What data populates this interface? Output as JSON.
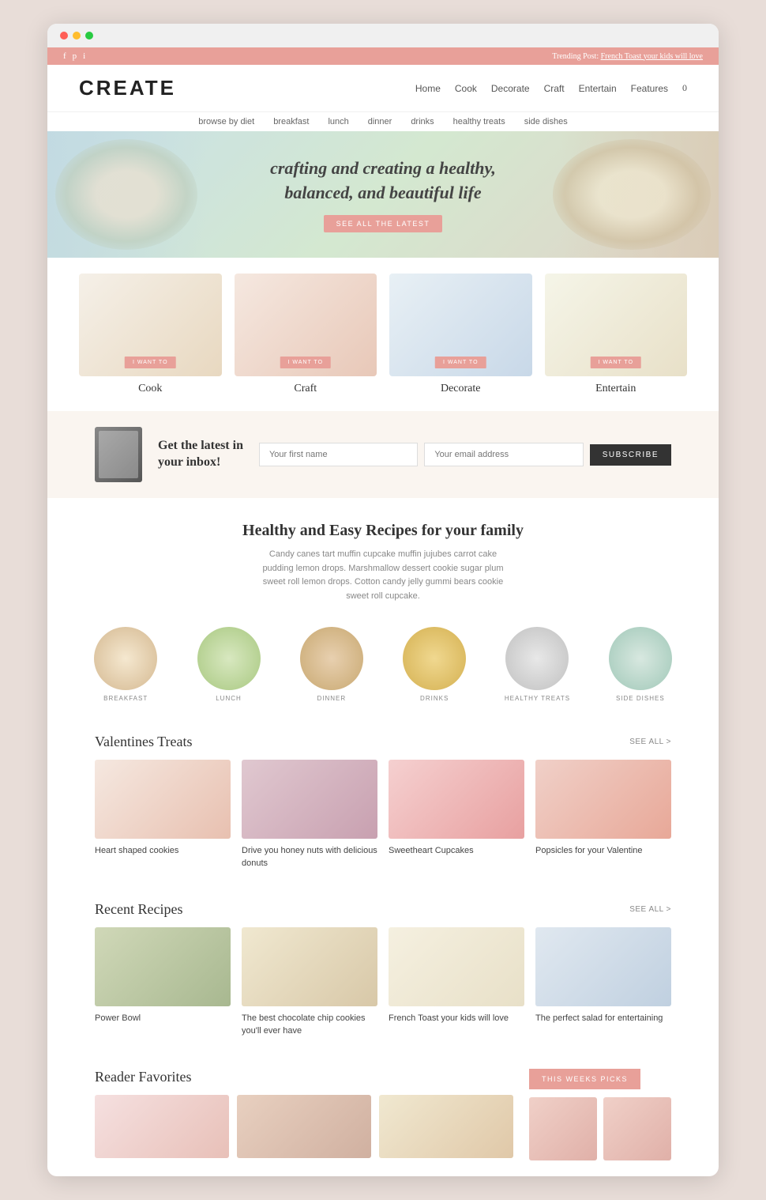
{
  "browser": {
    "dots": [
      "red",
      "yellow",
      "green"
    ]
  },
  "topbar": {
    "social_icons": [
      "f",
      "p",
      "i"
    ],
    "trending_label": "Trending Post:",
    "trending_link": "French Toast your kids will love"
  },
  "header": {
    "logo": "CREATE",
    "nav": [
      {
        "label": "Home",
        "has_dropdown": true
      },
      {
        "label": "Cook"
      },
      {
        "label": "Decorate"
      },
      {
        "label": "Craft"
      },
      {
        "label": "Entertain"
      },
      {
        "label": "Features",
        "has_dropdown": true
      },
      {
        "label": "0"
      }
    ]
  },
  "subnav": {
    "items": [
      {
        "label": "browse by diet"
      },
      {
        "label": "breakfast"
      },
      {
        "label": "lunch"
      },
      {
        "label": "dinner"
      },
      {
        "label": "drinks"
      },
      {
        "label": "healthy treats"
      },
      {
        "label": "side dishes"
      }
    ]
  },
  "hero": {
    "heading_line1": "crafting and creating a healthy,",
    "heading_line2": "balanced, and beautiful life",
    "button_label": "SEE ALL THE LATEST"
  },
  "categories": [
    {
      "label": "Cook",
      "btn": "I WANT TO",
      "img_class": "category-img-cook"
    },
    {
      "label": "Craft",
      "btn": "I WANT TO",
      "img_class": "category-img-craft"
    },
    {
      "label": "Decorate",
      "btn": "I WANT TO",
      "img_class": "category-img-decorate"
    },
    {
      "label": "Entertain",
      "btn": "I WANT TO",
      "img_class": "category-img-entertain"
    }
  ],
  "newsletter": {
    "heading_line1": "Get the latest in",
    "heading_line2": "your inbox!",
    "first_name_placeholder": "Your first name",
    "email_placeholder": "Your email address",
    "button_label": "SUBSCRIBE"
  },
  "recipes": {
    "title": "Healthy and Easy Recipes for your family",
    "description": "Candy canes tart muffin cupcake muffin jujubes carrot cake pudding lemon drops. Marshmallow dessert cookie sugar plum sweet roll lemon drops. Cotton candy jelly gummi bears cookie sweet roll cupcake.",
    "categories": [
      {
        "label": "BREAKFAST",
        "img_class": "food-circle-breakfast"
      },
      {
        "label": "LUNCH",
        "img_class": "food-circle-lunch"
      },
      {
        "label": "DINNER",
        "img_class": "food-circle-dinner"
      },
      {
        "label": "DRINKS",
        "img_class": "food-circle-drinks"
      },
      {
        "label": "HEALTHY TREATS",
        "img_class": "food-circle-healthy"
      },
      {
        "label": "SIDE DISHES",
        "img_class": "food-circle-sides"
      }
    ]
  },
  "valentines": {
    "section_title": "Valentines Treats",
    "see_all": "SEE ALL >",
    "posts": [
      {
        "title": "Heart shaped cookies",
        "img_class": "valentine1"
      },
      {
        "title": "Drive you honey nuts with delicious donuts",
        "img_class": "valentine2"
      },
      {
        "title": "Sweetheart Cupcakes",
        "img_class": "valentine3"
      },
      {
        "title": "Popsicles for your Valentine",
        "img_class": "valentine4"
      }
    ]
  },
  "recent_recipes": {
    "section_title": "Recent Recipes",
    "see_all": "SEE ALL >",
    "posts": [
      {
        "title": "Power Bowl",
        "img_class": "recipe1"
      },
      {
        "title": "The best chocolate chip cookies you'll ever have",
        "img_class": "recipe2"
      },
      {
        "title": "French Toast your kids will love",
        "img_class": "recipe3"
      },
      {
        "title": "The perfect salad for entertaining",
        "img_class": "recipe4"
      }
    ]
  },
  "reader_favorites": {
    "title": "Reader Favorites",
    "picks_btn": "THIS WEEKS PICKS"
  }
}
